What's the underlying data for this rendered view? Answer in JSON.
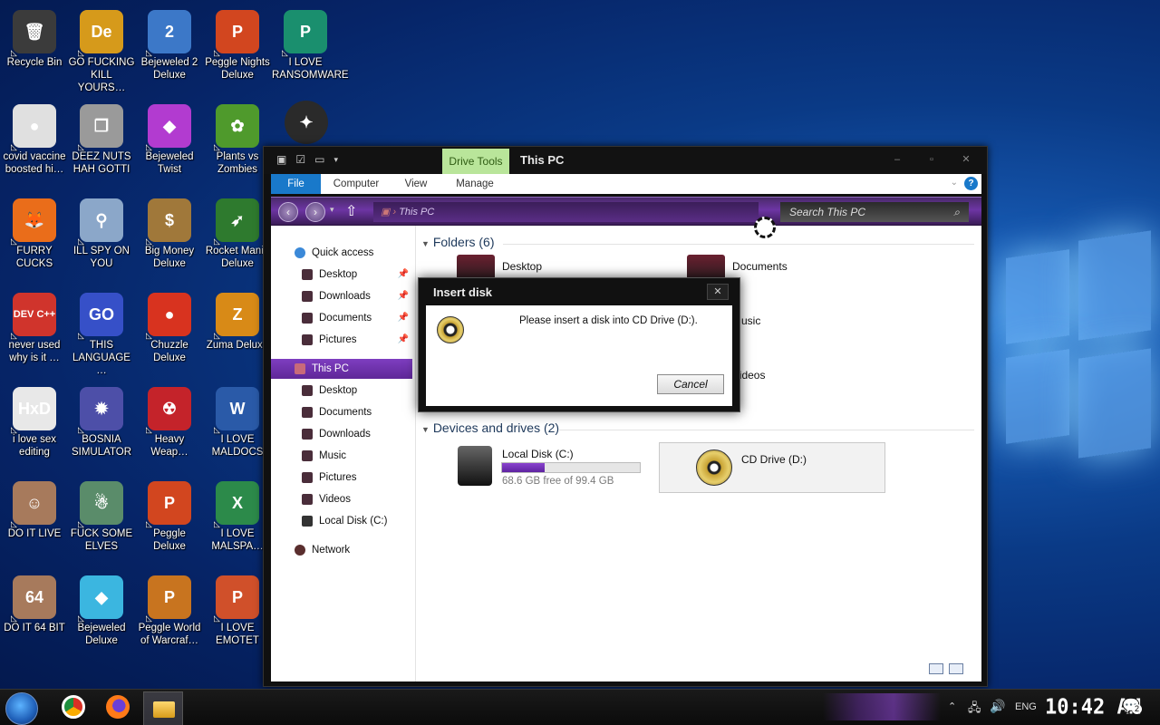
{
  "desktop": {
    "icons": [
      {
        "label": "Recycle Bin",
        "glyph": "🗑",
        "color": "#3b3b3b"
      },
      {
        "label": "GO FUCKING KILL YOURS…",
        "glyph": "De",
        "color": "#d69a1b"
      },
      {
        "label": "Bejeweled 2 Deluxe",
        "glyph": "2",
        "color": "#3c78c8"
      },
      {
        "label": "Peggle Nights Deluxe",
        "glyph": "P",
        "color": "#d2461f"
      },
      {
        "label": "I LOVE RANSOMWARE",
        "glyph": "P",
        "color": "#1a8f6e"
      },
      {
        "label": "covid vaccine boosted hi…",
        "glyph": "●",
        "color": "#e0e0e0"
      },
      {
        "label": "DEEZ NUTS HAH GOTTI",
        "glyph": "❐",
        "color": "#9a9a9a"
      },
      {
        "label": "Bejeweled Twist",
        "glyph": "◆",
        "color": "#b23bd0"
      },
      {
        "label": "Plants vs Zombies",
        "glyph": "✿",
        "color": "#4f9a2c"
      },
      {
        "label": "FURRY CUCKS",
        "glyph": "🦊",
        "color": "#ea6d1a"
      },
      {
        "label": "ILL SPY ON YOU",
        "glyph": "⚲",
        "color": "#8ba7c9"
      },
      {
        "label": "Big Money Deluxe",
        "glyph": "$",
        "color": "#a0783a"
      },
      {
        "label": "Rocket Mania Deluxe",
        "glyph": "➶",
        "color": "#2e7a2e"
      },
      {
        "label": "never used why is it …",
        "glyph": "DEV C++",
        "color": "#d0342c"
      },
      {
        "label": "THIS LANGUAGE …",
        "glyph": "GO",
        "color": "#3650c8"
      },
      {
        "label": "Chuzzle Deluxe",
        "glyph": "●",
        "color": "#d8331f"
      },
      {
        "label": "Zuma Deluxe",
        "glyph": "Z",
        "color": "#d88a17"
      },
      {
        "label": "i love sex editing",
        "glyph": "HxD",
        "color": "#e8e8e8"
      },
      {
        "label": "BOSNIA SIMULATOR",
        "glyph": "✹",
        "color": "#4d4fa8"
      },
      {
        "label": "Heavy Weap…",
        "glyph": "☢",
        "color": "#c4232a"
      },
      {
        "label": "I LOVE MALDOCS",
        "glyph": "W",
        "color": "#2a5aa8"
      },
      {
        "label": "DO IT LIVE",
        "glyph": "☺",
        "color": "#a77a5c"
      },
      {
        "label": "FUCK SOME ELVES",
        "glyph": "☃",
        "color": "#5a8c6a"
      },
      {
        "label": "Peggle Deluxe",
        "glyph": "P",
        "color": "#d2461f"
      },
      {
        "label": "I LOVE MALSPA…",
        "glyph": "X",
        "color": "#2c8a4a"
      },
      {
        "label": "DO IT 64 BIT",
        "glyph": "64",
        "color": "#a77a5c"
      },
      {
        "label": "Bejeweled Deluxe",
        "glyph": "◆",
        "color": "#3bb6e0"
      },
      {
        "label": "Peggle World of Warcraf…",
        "glyph": "P",
        "color": "#c8741f"
      },
      {
        "label": "I LOVE EMOTET",
        "glyph": "P",
        "color": "#d0502a"
      }
    ],
    "extra_icon": {
      "glyph": "✦",
      "color": "#2a2a2a"
    }
  },
  "explorer": {
    "qat_icons": [
      "folder-icon",
      "properties-icon",
      "new-folder-icon"
    ],
    "contextual_tab": "Drive Tools",
    "title": "This PC",
    "ribbon_tabs": [
      "File",
      "Computer",
      "View",
      "Manage"
    ],
    "address": "This PC",
    "search_placeholder": "Search This PC",
    "nav": {
      "quick_access": "Quick access",
      "qa_items": [
        "Desktop",
        "Downloads",
        "Documents",
        "Pictures"
      ],
      "this_pc": "This PC",
      "pc_items": [
        "Desktop",
        "Documents",
        "Downloads",
        "Music",
        "Pictures",
        "Videos",
        "Local Disk (C:)"
      ],
      "network": "Network"
    },
    "folders_header": "Folders (6)",
    "folders": [
      "Desktop",
      "Documents",
      "Music",
      "Videos"
    ],
    "devices_header": "Devices and drives (2)",
    "drives": {
      "c": {
        "name": "Local Disk (C:)",
        "free": "68.6 GB free of 99.4 GB",
        "used_fraction": 0.31
      },
      "d": {
        "name": "CD Drive (D:)"
      }
    }
  },
  "dialog": {
    "title": "Insert disk",
    "message": "Please insert a disk into CD Drive (D:).",
    "cancel": "Cancel",
    "close": "✕"
  },
  "taskbar": {
    "lang": "ENG",
    "clock": "10:42 AM",
    "notifications": "2"
  },
  "colors": {
    "accent_purple": "#6d35a4",
    "file_tab_blue": "#1979ca",
    "drive_tools_green": "#b9e59a"
  }
}
